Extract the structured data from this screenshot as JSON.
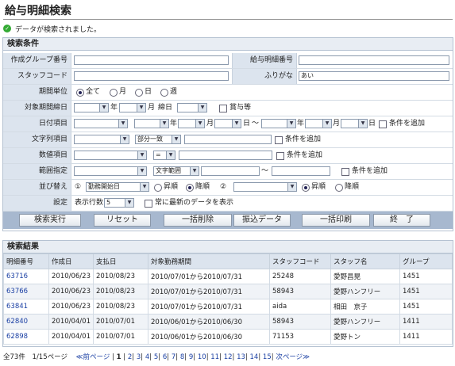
{
  "page": {
    "title": "給与明細検索",
    "message": "データが検索されました。"
  },
  "search": {
    "header": "検索条件",
    "group_label": "作成グループ番号",
    "detail_no_label": "給与明細番号",
    "staff_code_label": "スタッフコード",
    "furigana_label": "ふりがな",
    "furigana_value": "あい",
    "period_unit_label": "期間単位",
    "period_units": [
      "全て",
      "月",
      "日",
      "週"
    ],
    "target_label": "対象期間締日",
    "year": "年",
    "month": "月",
    "day": "日",
    "closing_day": "締日",
    "bonus_label": "賞与等",
    "date_item_label": "日付項目",
    "tilde": "～",
    "add_condition": "条件を追加",
    "string_item_label": "文字列項目",
    "partial_match": "部分一致",
    "numeric_item_label": "数値項目",
    "equals": "=",
    "range_label": "範囲指定",
    "text_range": "文字範囲",
    "sort_label": "並び替え",
    "sort_num1": "①",
    "sort_num2": "②",
    "sort_key1": "勤務開始日",
    "asc": "昇順",
    "desc": "降順",
    "settings_label": "設定",
    "rows_label": "表示行数",
    "rows_value": "5",
    "always_latest": "常に最新のデータを表示"
  },
  "buttons": {
    "search": "検索実行",
    "reset": "リセット",
    "bulk_delete": "一括削除",
    "transfer": "振込データ",
    "bulk_print": "一括印刷",
    "end": "終　了"
  },
  "results": {
    "header": "検索結果",
    "columns": [
      "明細番号",
      "作成日",
      "支払日",
      "対象勤務期間",
      "スタッフコード",
      "スタッフ名",
      "グループ"
    ],
    "rows": [
      [
        "63716",
        "2010/06/23",
        "2010/08/23",
        "2010/07/01から2010/07/31",
        "25248",
        "愛野昌晃",
        "1451"
      ],
      [
        "63766",
        "2010/06/23",
        "2010/08/23",
        "2010/07/01から2010/07/31",
        "58943",
        "愛野ハンフリー",
        "1451"
      ],
      [
        "63841",
        "2010/06/23",
        "2010/08/23",
        "2010/07/01から2010/07/31",
        "aida",
        "相田　京子",
        "1451"
      ],
      [
        "62840",
        "2010/04/01",
        "2010/07/01",
        "2010/06/01から2010/06/30",
        "58943",
        "愛野ハンフリー",
        "1411"
      ],
      [
        "62898",
        "2010/04/01",
        "2010/07/01",
        "2010/06/01から2010/06/30",
        "71153",
        "愛野トン",
        "1411"
      ]
    ]
  },
  "pager": {
    "total": "全73件",
    "page_info": "1/15ページ",
    "prev": "≪前ページ",
    "sep": "|",
    "current": "1",
    "pages": [
      "2",
      "3",
      "4",
      "5",
      "6",
      "7",
      "8",
      "9",
      "10",
      "11",
      "12",
      "13",
      "14",
      "15"
    ],
    "next": "次ページ≫"
  }
}
